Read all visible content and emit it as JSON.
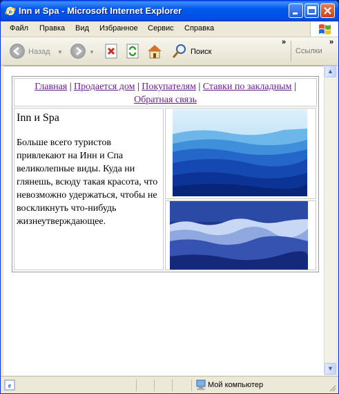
{
  "window": {
    "title": "Inn и Spa - Microsoft Internet Explorer"
  },
  "menu": {
    "items": [
      "Файл",
      "Правка",
      "Вид",
      "Избранное",
      "Сервис",
      "Справка"
    ]
  },
  "toolbar": {
    "back_label": "Назад",
    "search_label": "Поиск",
    "links_label": "Ссылки"
  },
  "page": {
    "nav": [
      "Главная",
      "Продается дом",
      "Покупателям",
      "Ставки по закладным",
      "Обратная связь"
    ],
    "heading": "Inn и Spa",
    "paragraph": "Больше всего туристов привлекают на Инн и Спа великолепные виды. Куда ни глянешь, всюду такая красота, что невозможно удержаться, чтобы не воскликнуть что-нибудь жизнеутверждающее."
  },
  "status": {
    "zone": "Мой компьютер"
  },
  "colors": {
    "titlebar": "#0058ee",
    "link_visited": "#6b1d8f",
    "mountain_sky": "#bfe3f7",
    "forest": "#1e3a8f"
  }
}
